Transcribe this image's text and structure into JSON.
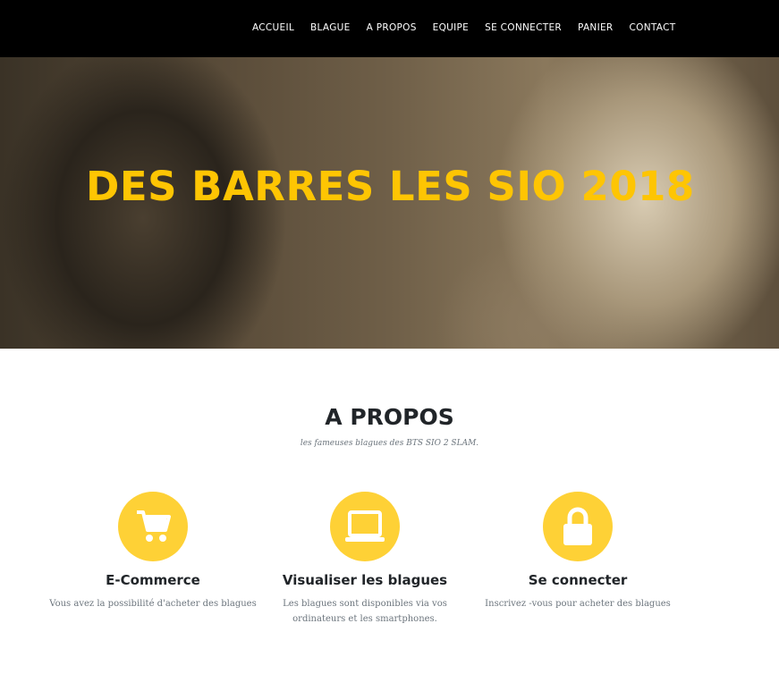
{
  "nav": {
    "items": [
      "ACCUEIL",
      "BLAGUE",
      "A PROPOS",
      "EQUIPE",
      "SE CONNECTER",
      "PANIER",
      "CONTACT"
    ]
  },
  "hero": {
    "title": "DES BARRES LES SIO 2018"
  },
  "about": {
    "title": "A PROPOS",
    "subtitle": "les fameuses blagues des BTS SIO 2 SLAM.",
    "features": [
      {
        "icon": "shopping-cart-icon",
        "title": "E-Commerce",
        "text": "Vous avez la possibilité d'acheter des blagues"
      },
      {
        "icon": "laptop-icon",
        "title": "Visualiser les blagues",
        "text": "Les blagues sont disponibles via vos ordinateurs et les smartphones."
      },
      {
        "icon": "lock-icon",
        "title": "Se connecter",
        "text": "Inscrivez -vous pour acheter des blagues"
      }
    ]
  },
  "colors": {
    "accent": "#fed136",
    "heading": "#fec503"
  }
}
